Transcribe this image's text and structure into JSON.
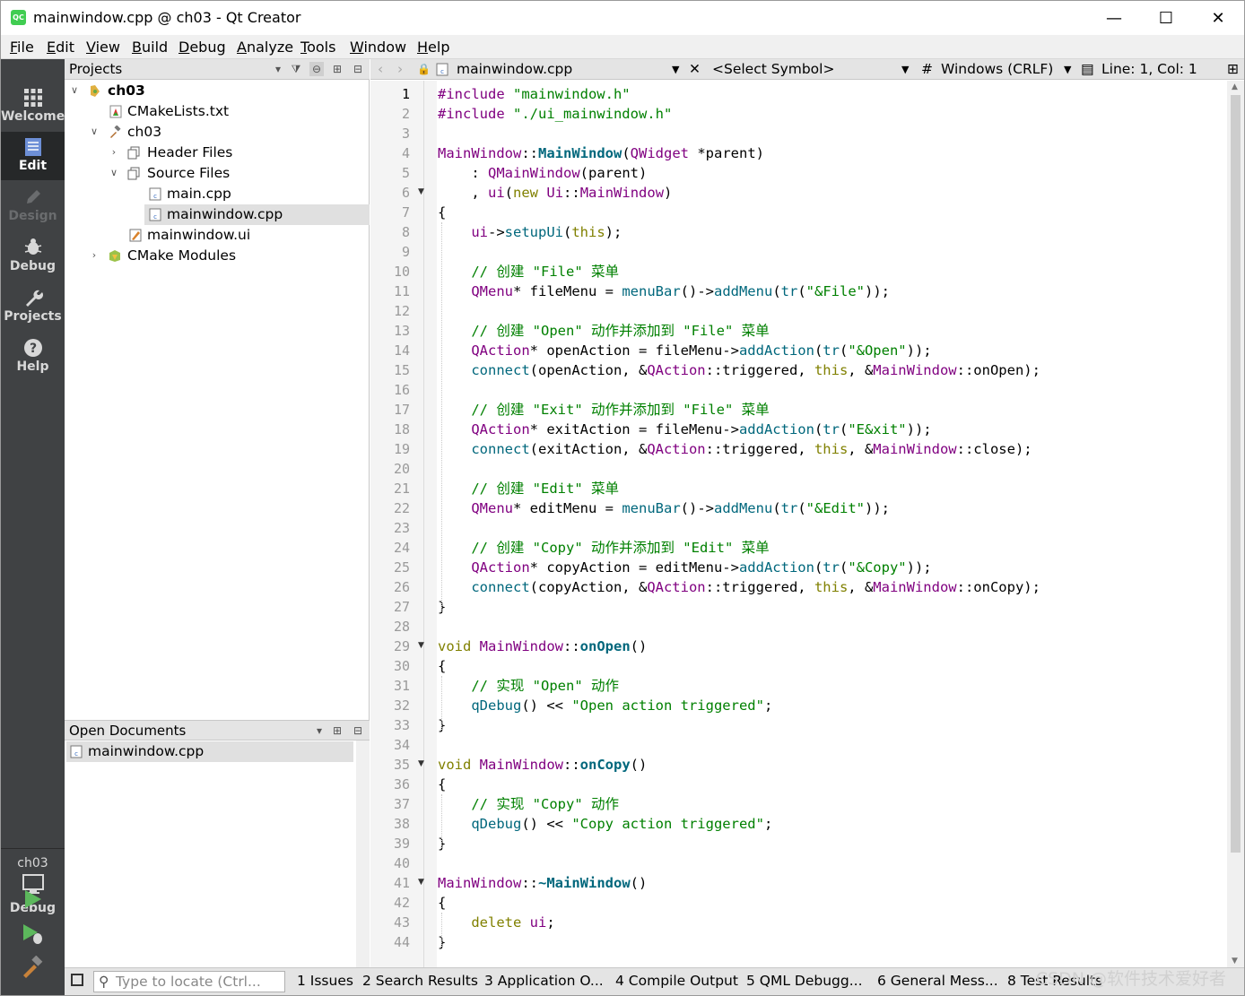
{
  "window": {
    "title": "mainwindow.cpp @ ch03 - Qt Creator",
    "app_icon_text": "QC",
    "minimize": "—",
    "maximize": "☐",
    "close": "✕"
  },
  "menu": [
    "File",
    "Edit",
    "View",
    "Build",
    "Debug",
    "Analyze",
    "Tools",
    "Window",
    "Help"
  ],
  "modes": [
    {
      "label": "Welcome",
      "icon": "grid-icon",
      "state": "normal"
    },
    {
      "label": "Edit",
      "icon": "document-icon",
      "state": "active"
    },
    {
      "label": "Design",
      "icon": "pencil-icon",
      "state": "disabled"
    },
    {
      "label": "Debug",
      "icon": "bug-icon",
      "state": "normal"
    },
    {
      "label": "Projects",
      "icon": "wrench-icon",
      "state": "normal"
    },
    {
      "label": "Help",
      "icon": "help-icon",
      "state": "normal"
    }
  ],
  "target": {
    "project": "ch03",
    "config": "Debug"
  },
  "projects_pane": {
    "title": "Projects",
    "tree": [
      {
        "label": "ch03",
        "depth": 0,
        "expanded": true,
        "bold": true,
        "icon": "cmake-project-icon"
      },
      {
        "label": "CMakeLists.txt",
        "depth": 1,
        "icon": "cmake-file-icon"
      },
      {
        "label": "ch03",
        "depth": 1,
        "expanded": true,
        "icon": "hammer-icon"
      },
      {
        "label": "Header Files",
        "depth": 2,
        "expanded": false,
        "icon": "folder-icon"
      },
      {
        "label": "Source Files",
        "depth": 2,
        "expanded": true,
        "icon": "folder-icon"
      },
      {
        "label": "main.cpp",
        "depth": 3,
        "icon": "cpp-file-icon"
      },
      {
        "label": "mainwindow.cpp",
        "depth": 3,
        "icon": "cpp-file-icon",
        "selected": true
      },
      {
        "label": "mainwindow.ui",
        "depth": 2,
        "icon": "ui-file-icon"
      },
      {
        "label": "CMake Modules",
        "depth": 1,
        "expanded": false,
        "icon": "cmake-modules-icon"
      }
    ]
  },
  "open_documents": {
    "title": "Open Documents",
    "items": [
      "mainwindow.cpp"
    ]
  },
  "editor_header": {
    "file": "mainwindow.cpp",
    "symbol": "<Select Symbol>",
    "hash": "#",
    "encoding": "Windows (CRLF)",
    "position": "Line: 1, Col: 1"
  },
  "code_lines": [
    "#include \"mainwindow.h\"",
    "#include \"./ui_mainwindow.h\"",
    "",
    "MainWindow::MainWindow(QWidget *parent)",
    "    : QMainWindow(parent)",
    "    , ui(new Ui::MainWindow)",
    "{",
    "    ui->setupUi(this);",
    "",
    "    // 创建 \"File\" 菜单",
    "    QMenu* fileMenu = menuBar()->addMenu(tr(\"&File\"));",
    "",
    "    // 创建 \"Open\" 动作并添加到 \"File\" 菜单",
    "    QAction* openAction = fileMenu->addAction(tr(\"&Open\"));",
    "    connect(openAction, &QAction::triggered, this, &MainWindow::onOpen);",
    "",
    "    // 创建 \"Exit\" 动作并添加到 \"File\" 菜单",
    "    QAction* exitAction = fileMenu->addAction(tr(\"E&xit\"));",
    "    connect(exitAction, &QAction::triggered, this, &MainWindow::close);",
    "",
    "    // 创建 \"Edit\" 菜单",
    "    QMenu* editMenu = menuBar()->addMenu(tr(\"&Edit\"));",
    "",
    "    // 创建 \"Copy\" 动作并添加到 \"Edit\" 菜单",
    "    QAction* copyAction = editMenu->addAction(tr(\"&Copy\"));",
    "    connect(copyAction, &QAction::triggered, this, &MainWindow::onCopy);",
    "}",
    "",
    "void MainWindow::onOpen()",
    "{",
    "    // 实现 \"Open\" 动作",
    "    qDebug() << \"Open action triggered\";",
    "}",
    "",
    "void MainWindow::onCopy()",
    "{",
    "    // 实现 \"Copy\" 动作",
    "    qDebug() << \"Copy action triggered\";",
    "}",
    "",
    "MainWindow::~MainWindow()",
    "{",
    "    delete ui;",
    "}"
  ],
  "fold_lines": [
    6,
    29,
    35,
    41
  ],
  "current_line": 1,
  "status": {
    "locate_placeholder": "Type to locate (Ctrl...",
    "tabs": [
      "1 Issues",
      "2 Search Results",
      "3 Application O...",
      "4 Compile Output",
      "5 QML Debugg...",
      "6 General Mess...",
      "8 Test Results"
    ],
    "watermark": "CSDN @软件技术爱好者"
  },
  "colors": {
    "keyword": "#808000",
    "type": "#800080",
    "function": "#00677c",
    "string": "#008000",
    "comment": "#008000",
    "operator": "#000000"
  }
}
